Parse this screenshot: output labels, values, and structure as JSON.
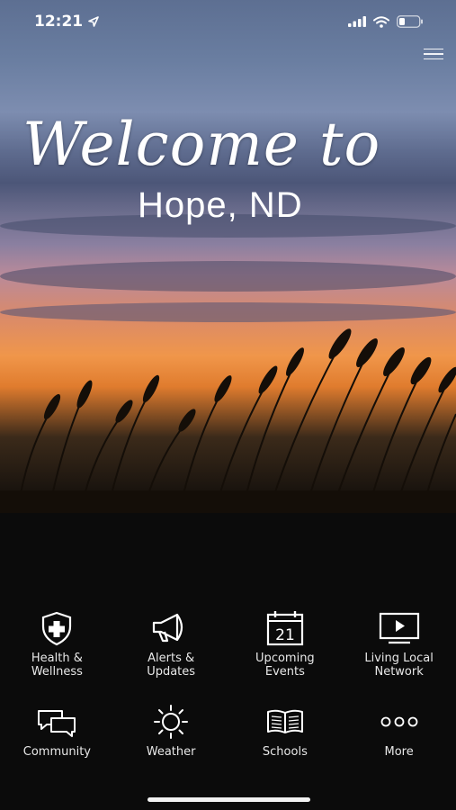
{
  "status_bar": {
    "time": "12:21"
  },
  "hero": {
    "welcome": "Welcome to",
    "town": "Hope, ND"
  },
  "grid": {
    "row1": [
      {
        "line1": "Health &",
        "line2": "Wellness",
        "icon": "shield-cross-icon"
      },
      {
        "line1": "Alerts &",
        "line2": "Updates",
        "icon": "megaphone-icon"
      },
      {
        "line1": "Upcoming",
        "line2": "Events",
        "icon": "calendar-icon",
        "date": "21"
      },
      {
        "line1": "Living Local",
        "line2": "Network",
        "icon": "video-play-icon"
      }
    ],
    "row2": [
      {
        "label": "Community",
        "icon": "chat-bubbles-icon"
      },
      {
        "label": "Weather",
        "icon": "sun-icon"
      },
      {
        "label": "Schools",
        "icon": "open-book-icon"
      },
      {
        "label": "More",
        "icon": "more-dots-icon"
      }
    ]
  }
}
